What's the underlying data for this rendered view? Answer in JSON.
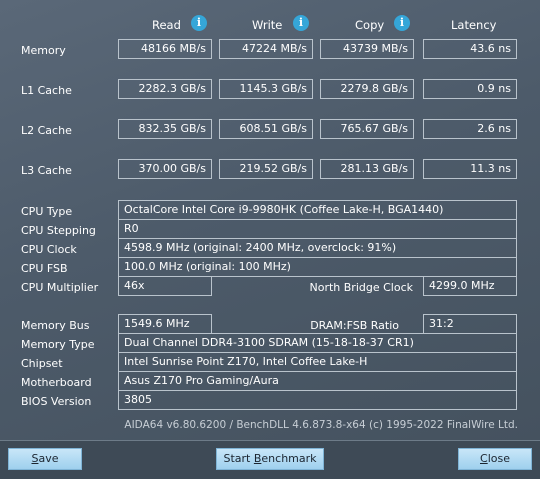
{
  "headers": {
    "read": "Read",
    "write": "Write",
    "copy": "Copy",
    "latency": "Latency"
  },
  "bench": [
    {
      "label": "Memory",
      "read": "48166 MB/s",
      "write": "47224 MB/s",
      "copy": "43739 MB/s",
      "latency": "43.6 ns"
    },
    {
      "label": "L1 Cache",
      "read": "2282.3 GB/s",
      "write": "1145.3 GB/s",
      "copy": "2279.8 GB/s",
      "latency": "0.9 ns"
    },
    {
      "label": "L2 Cache",
      "read": "832.35 GB/s",
      "write": "608.51 GB/s",
      "copy": "765.67 GB/s",
      "latency": "2.6 ns"
    },
    {
      "label": "L3 Cache",
      "read": "370.00 GB/s",
      "write": "219.52 GB/s",
      "copy": "281.13 GB/s",
      "latency": "11.3 ns"
    }
  ],
  "cpu": {
    "type_label": "CPU Type",
    "type_value": "OctalCore Intel Core i9-9980HK  (Coffee Lake-H, BGA1440)",
    "stepping_label": "CPU Stepping",
    "stepping_value": "R0",
    "clock_label": "CPU Clock",
    "clock_value": "4598.9 MHz  (original: 2400 MHz, overclock: 91%)",
    "fsb_label": "CPU FSB",
    "fsb_value": "100.0 MHz  (original: 100 MHz)",
    "multiplier_label": "CPU Multiplier",
    "multiplier_value": "46x",
    "nb_clock_label": "North Bridge Clock",
    "nb_clock_value": "4299.0 MHz"
  },
  "memory": {
    "bus_label": "Memory Bus",
    "bus_value": "1549.6 MHz",
    "ratio_label": "DRAM:FSB Ratio",
    "ratio_value": "31:2",
    "type_label": "Memory Type",
    "type_value": "Dual Channel DDR4-3100 SDRAM  (15-18-18-37 CR1)",
    "chipset_label": "Chipset",
    "chipset_value": "Intel Sunrise Point Z170, Intel Coffee Lake-H",
    "motherboard_label": "Motherboard",
    "motherboard_value": "Asus Z170 Pro Gaming/Aura",
    "bios_label": "BIOS Version",
    "bios_value": "3805"
  },
  "footer": {
    "copyright": "AIDA64 v6.80.6200 / BenchDLL 4.6.873.8-x64  (c) 1995-2022 FinalWire Ltd.",
    "save_first": "S",
    "save_rest": "ave",
    "start_pre": "Start ",
    "start_u": "B",
    "start_post": "enchmark",
    "close_first": "C",
    "close_rest": "lose"
  },
  "icons": [
    "info-icon"
  ],
  "colors": {
    "accent": "#35a6d8",
    "panel": "#4d5b6a",
    "button": "#b4dcf4"
  }
}
